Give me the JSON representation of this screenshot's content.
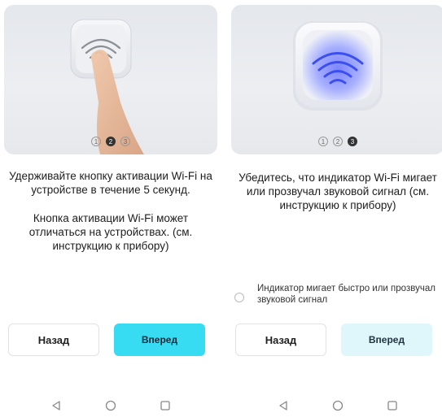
{
  "step2": {
    "pager": [
      "1",
      "2",
      "3"
    ],
    "active_step": 2,
    "instruction": "Удерживайте кнопку активации Wi-Fi на устройстве в течение 5 секунд.",
    "note": "Кнопка активации Wi-Fi может отличаться на устройствах. (см. инструкцию к прибору)",
    "back_label": "Назад",
    "next_label": "Вперед",
    "accent_color": "#37dcf2"
  },
  "step3": {
    "pager": [
      "1",
      "2",
      "3"
    ],
    "active_step": 3,
    "instruction": "Убедитесь, что индикатор Wi-Fi мигает или прозвучал звуковой сигнал (см. инструкцию к прибору)",
    "checkbox_label": "Индикатор мигает быстро или прозвучал звуковой сигнал",
    "checkbox_checked": false,
    "back_label": "Назад",
    "next_label": "Вперед",
    "next_enabled": false,
    "indicator_color": "#5b6cff"
  },
  "navbar": {
    "items": [
      "back-icon",
      "home-icon",
      "recents-icon"
    ]
  }
}
